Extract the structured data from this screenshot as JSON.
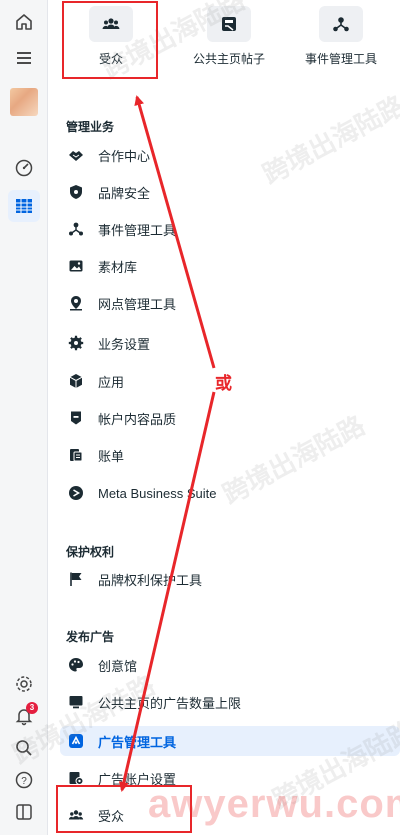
{
  "shortcuts": [
    {
      "label": "受众",
      "icon": "people-icon"
    },
    {
      "label": "公共主页帖子",
      "icon": "post-icon"
    },
    {
      "label": "事件管理工具",
      "icon": "events-icon"
    }
  ],
  "sections": {
    "manage": "管理业务",
    "protect": "保护权利",
    "ads": "发布广告"
  },
  "menu": {
    "partner_center": "合作中心",
    "brand_safety": "品牌安全",
    "events_manager": "事件管理工具",
    "media_library": "素材库",
    "locations": "网点管理工具",
    "business_settings": "业务设置",
    "apps": "应用",
    "account_quality": "帐户内容品质",
    "billing": "账单",
    "meta_suite": "Meta Business Suite",
    "brand_rights": "品牌权利保护工具",
    "creative_hub": "创意馆",
    "page_ad_limit": "公共主页的广告数量上限",
    "ads_manager": "广告管理工具",
    "ad_account_settings": "广告账户设置",
    "audiences": "受众"
  },
  "rail": {
    "notification_count": "3"
  },
  "annotation": {
    "or_text": "或"
  },
  "watermark": {
    "text": "跨境出海陆路",
    "url": "awyerwu.com"
  },
  "colors": {
    "accent": "#0064e0",
    "annotation_red": "#e8262a",
    "badge_red": "#e41e3f"
  }
}
